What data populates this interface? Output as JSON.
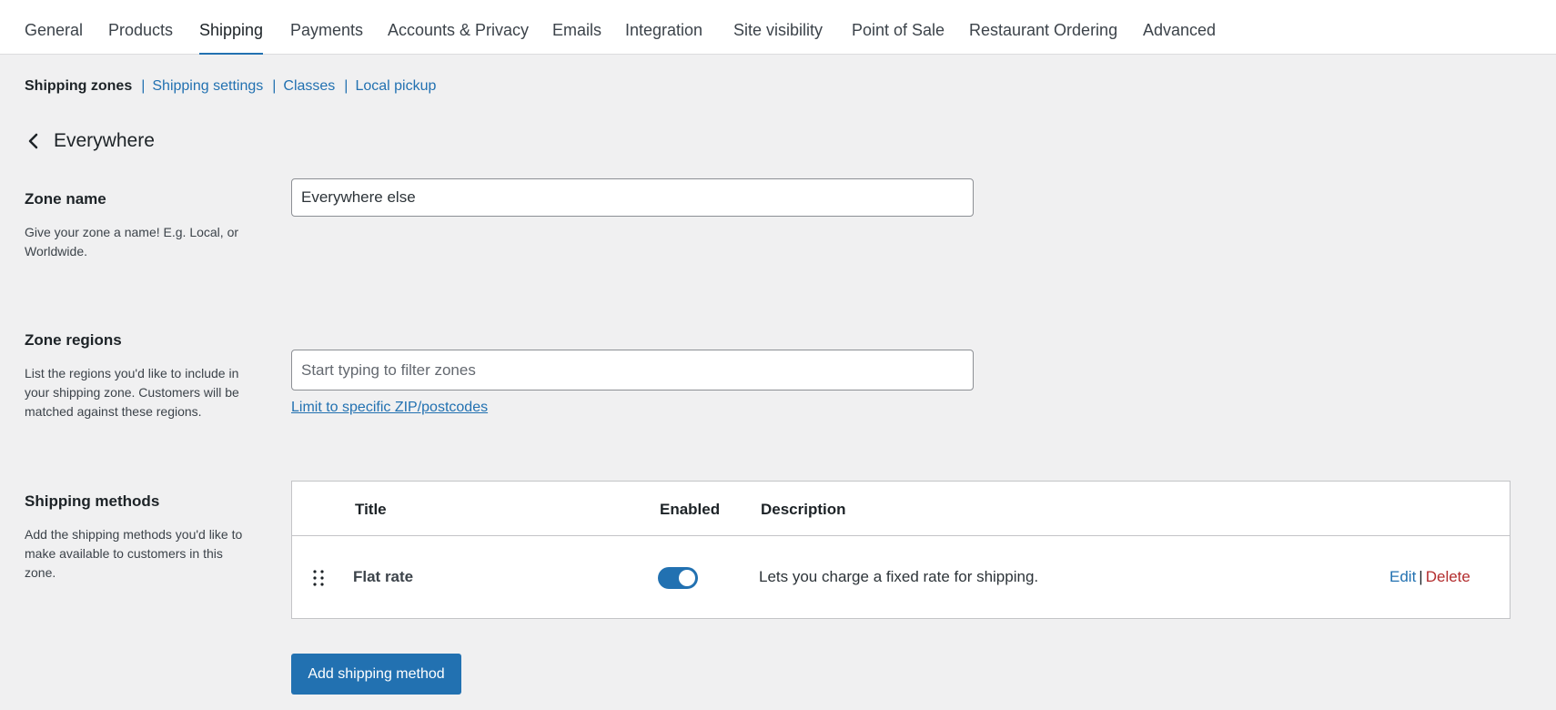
{
  "tabs": [
    {
      "label": "General"
    },
    {
      "label": "Products"
    },
    {
      "label": "Shipping",
      "active": true
    },
    {
      "label": "Payments"
    },
    {
      "label": "Accounts & Privacy"
    },
    {
      "label": "Emails"
    },
    {
      "label": "Integration"
    },
    {
      "label": "Site visibility"
    },
    {
      "label": "Point of Sale"
    },
    {
      "label": "Restaurant Ordering"
    },
    {
      "label": "Advanced"
    }
  ],
  "subnav": {
    "current": "Shipping zones",
    "links": [
      "Shipping settings",
      "Classes",
      "Local pickup"
    ],
    "separator": "|"
  },
  "page": {
    "back_icon": "chevron-left-icon",
    "title": "Everywhere"
  },
  "zone_name": {
    "label": "Zone name",
    "description": "Give your zone a name! E.g. Local, or Worldwide.",
    "value": "Everywhere else"
  },
  "zone_regions": {
    "label": "Zone regions",
    "description": "List the regions you'd like to include in your shipping zone. Customers will be matched against these regions.",
    "placeholder": "Start typing to filter zones",
    "limit_link": "Limit to specific ZIP/postcodes"
  },
  "shipping_methods": {
    "label": "Shipping methods",
    "description": "Add the shipping methods you'd like to make available to customers in this zone.",
    "columns": {
      "title": "Title",
      "enabled": "Enabled",
      "description": "Description"
    },
    "rows": [
      {
        "title": "Flat rate",
        "enabled": true,
        "description": "Lets you charge a fixed rate for shipping.",
        "edit": "Edit",
        "pipe": "|",
        "delete": "Delete"
      }
    ],
    "add_button": "Add shipping method"
  },
  "colors": {
    "accent": "#2271b1",
    "delete": "#b32d2e",
    "background": "#f0f0f1"
  }
}
